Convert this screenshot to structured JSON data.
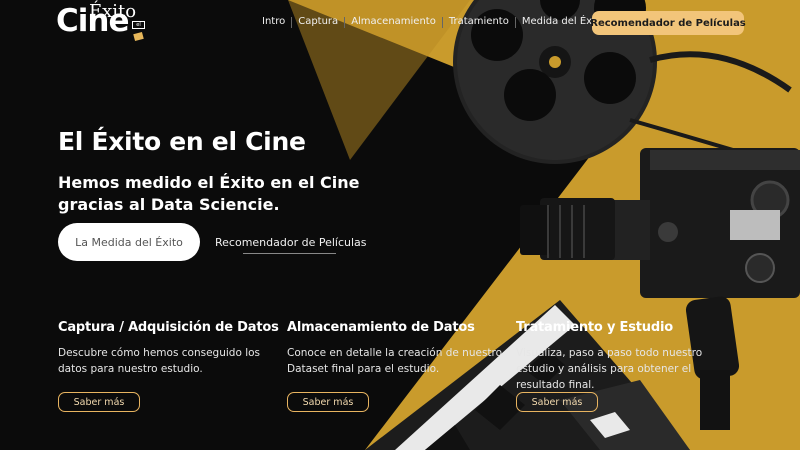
{
  "logo": {
    "big": "Cine",
    "small": "Éxito",
    "tag": "el"
  },
  "nav": {
    "items": [
      "Intro",
      "Captura",
      "Almacenamiento",
      "Tratamiento",
      "Medida del Éxito"
    ],
    "cta": "Recomendador de Películas"
  },
  "hero": {
    "title": "El Éxito en el Cine",
    "subtitle": "Hemos medido el Éxito en el Cine gracias al Data Sciencie.",
    "primary_button": "La Medida del Éxito",
    "secondary_link": "Recomendador de Películas"
  },
  "cards": [
    {
      "title": "Captura / Adquisición de Datos",
      "text": "Descubre cómo hemos conseguido los datos para nuestro estudio.",
      "button": "Saber más"
    },
    {
      "title": "Almacenamiento de Datos",
      "text": "Conoce en detalle la creación de nuestro Dataset final para el estudio.",
      "button": "Saber más"
    },
    {
      "title": "Tratamiento y Estudio",
      "text": "Visualiza, paso a paso todo nuestro estudio y análisis para obtener el resultado final.",
      "button": "Saber más"
    }
  ],
  "colors": {
    "accent": "#f2c57a",
    "background_yellow": "#c99b2c",
    "background_dark": "#0b0b0b"
  },
  "icons": [
    "film-reel-icon",
    "film-camera-icon",
    "clapperboard-icon"
  ]
}
